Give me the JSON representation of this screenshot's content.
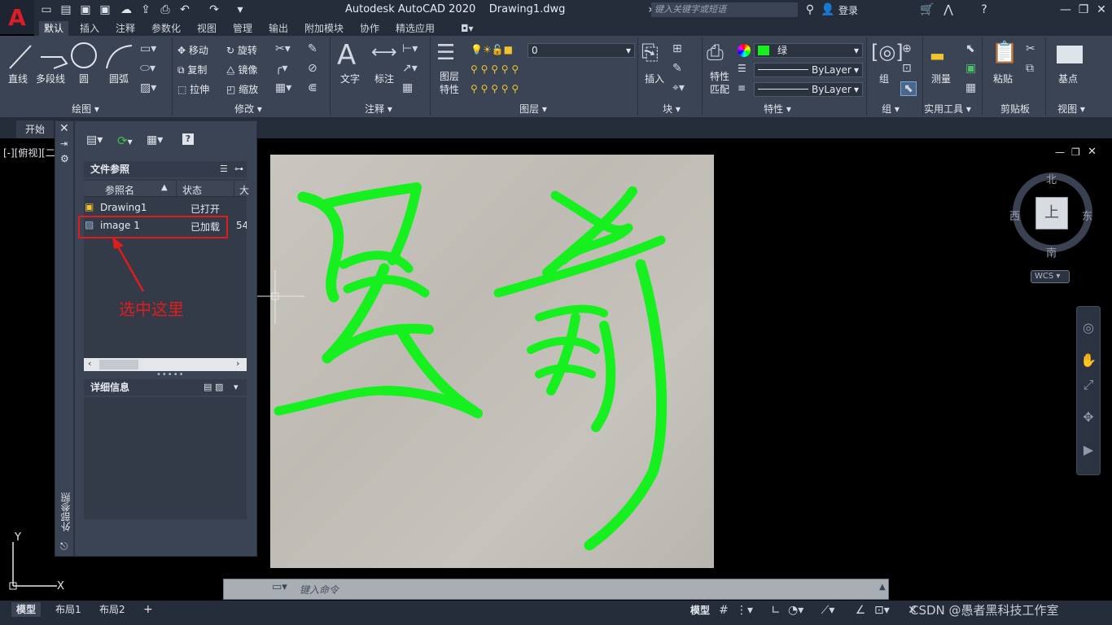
{
  "title_bar": {
    "app_title": "Autodesk AutoCAD 2020",
    "file_name": "Drawing1.dwg",
    "search_placeholder": "键入关键字或短语",
    "login_label": "登录"
  },
  "ribbon_tabs": [
    "默认",
    "插入",
    "注释",
    "参数化",
    "视图",
    "管理",
    "输出",
    "附加模块",
    "协作",
    "精选应用"
  ],
  "ribbon": {
    "draw": {
      "title": "绘图",
      "tools": [
        "直线",
        "多段线",
        "圆",
        "圆弧"
      ]
    },
    "modify": {
      "title": "修改",
      "tools": [
        "移动",
        "旋转",
        "复制",
        "镜像",
        "拉伸",
        "缩放"
      ]
    },
    "annotation": {
      "title": "注释",
      "tools": [
        "文字",
        "标注"
      ]
    },
    "layers": {
      "title": "图层",
      "properties_label": "图层\n特性",
      "current_layer": "0"
    },
    "block": {
      "title": "块",
      "insert_label": "插入"
    },
    "properties": {
      "title": "特性",
      "match_label": "特性\n匹配",
      "color_value": "绿",
      "linetype_value": "ByLayer",
      "lineweight_value": "ByLayer"
    },
    "groups": {
      "title": "组",
      "group_label": "组"
    },
    "utilities": {
      "title": "实用工具",
      "measure_label": "测量"
    },
    "clipboard": {
      "title": "剪贴板",
      "paste_label": "粘贴"
    },
    "view": {
      "title": "视图",
      "base_label": "基点"
    }
  },
  "file_tab": {
    "start_label": "开始"
  },
  "viewport_label": "[-][俯视][二",
  "xref_palette": {
    "vertical_title": "外部参照",
    "file_refs_header": "文件参照",
    "columns": [
      "参照名",
      "状态",
      "大"
    ],
    "rows": [
      {
        "name": "Drawing1",
        "status": "已打开",
        "size": ""
      },
      {
        "name": "image 1",
        "status": "已加载",
        "size": "54"
      }
    ],
    "details_header": "详细信息"
  },
  "annotation_text": "选中这里",
  "viewcube": {
    "north": "北",
    "south": "南",
    "east": "东",
    "west": "西",
    "face": "上",
    "wcs": "WCS"
  },
  "command_line": {
    "placeholder": "键入命令"
  },
  "layout_tabs": [
    "模型",
    "布局1",
    "布局2"
  ],
  "status_bar": {
    "model_label": "模型"
  },
  "watermark": "CSDN @愚者黑科技工作室",
  "colors": {
    "accent_red": "#e11c1c",
    "ink_green": "#16f01e",
    "ribbon_bg": "#3b4455",
    "titlebar_bg": "#262d3a"
  }
}
